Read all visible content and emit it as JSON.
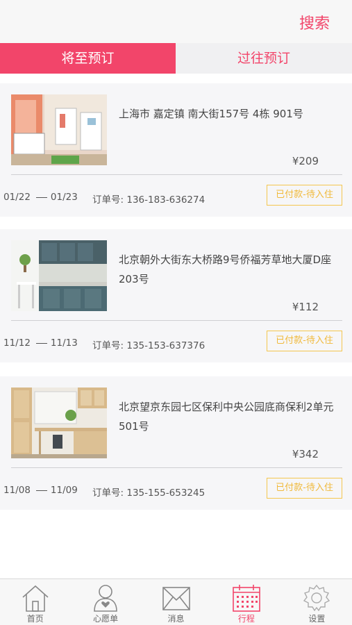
{
  "header": {
    "search_label": "搜索"
  },
  "tabs": [
    {
      "label": "将至预订",
      "active": true
    },
    {
      "label": "过往预订",
      "active": false
    }
  ],
  "bookings": [
    {
      "address": "上海市 嘉定镇 南大街157号 4栋 901号",
      "price": "¥209",
      "check_in": "01/22",
      "check_out": "01/23",
      "order_label": "订单号:",
      "order_no": "136-183-636274",
      "status": "已付款-待入住",
      "image": "kids-bedroom-photo"
    },
    {
      "address": "北京朝外大街东大桥路9号侨福芳草地大厦D座203号",
      "price": "¥112",
      "check_in": "11/12",
      "check_out": "11/13",
      "order_label": "订单号:",
      "order_no": "135-153-637376",
      "status": "已付款-待入住",
      "image": "kitchen-photo"
    },
    {
      "address": "北京望京东园七区保利中央公园底商保利2单元501号",
      "price": "¥342",
      "check_in": "11/08",
      "check_out": "11/09",
      "order_label": "订单号:",
      "order_no": "135-155-653245",
      "status": "已付款-待入住",
      "image": "study-room-photo"
    }
  ],
  "tabbar": [
    {
      "label": "首页",
      "icon": "home-icon",
      "active": false
    },
    {
      "label": "心愿单",
      "icon": "wishlist-icon",
      "active": false
    },
    {
      "label": "消息",
      "icon": "message-icon",
      "active": false
    },
    {
      "label": "行程",
      "icon": "calendar-icon",
      "active": true
    },
    {
      "label": "设置",
      "icon": "settings-icon",
      "active": false
    }
  ],
  "colors": {
    "accent": "#f2456a",
    "status": "#f0b93a",
    "card_bg": "#f6f6f8"
  }
}
